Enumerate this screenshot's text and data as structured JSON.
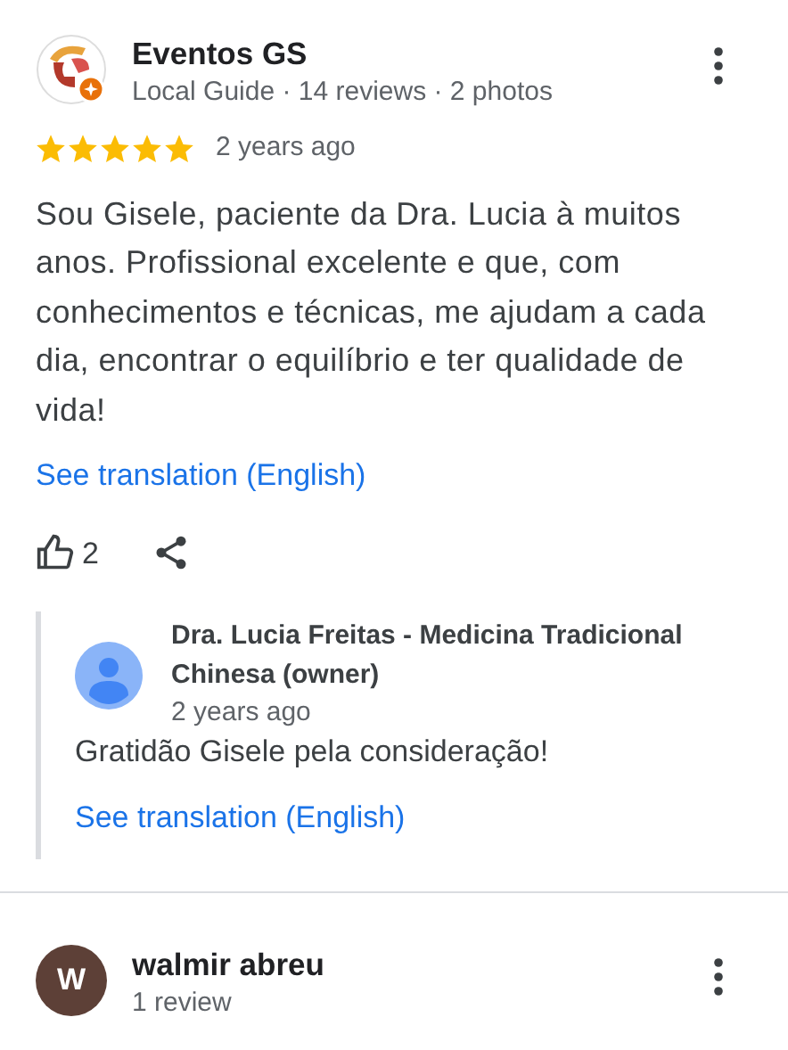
{
  "reviews": [
    {
      "author": "Eventos GS",
      "avatar": {
        "kind": "logo"
      },
      "meta": "Local Guide · 14 reviews · 2 photos",
      "stars": 5,
      "date": "2 years ago",
      "text": "Sou Gisele, paciente da Dra. Lucia à muitos anos. Profissional excelente e que, com conhecimentos e técnicas, me ajudam a cada dia, encontrar o equilíbrio e ter qualidade de vida!",
      "translation_link": "See translation (English)",
      "likes": "2",
      "reply": {
        "author": "Dra. Lucia Freitas - Medicina Tradicional Chinesa (owner)",
        "date": "2 years ago",
        "text": "Gratidão Gisele pela consideração!",
        "translation_link": "See translation (English)"
      }
    },
    {
      "author": "walmir abreu",
      "avatar": {
        "kind": "initial",
        "letter": "W",
        "color": "#5d4037"
      },
      "meta": "1 review"
    }
  ]
}
